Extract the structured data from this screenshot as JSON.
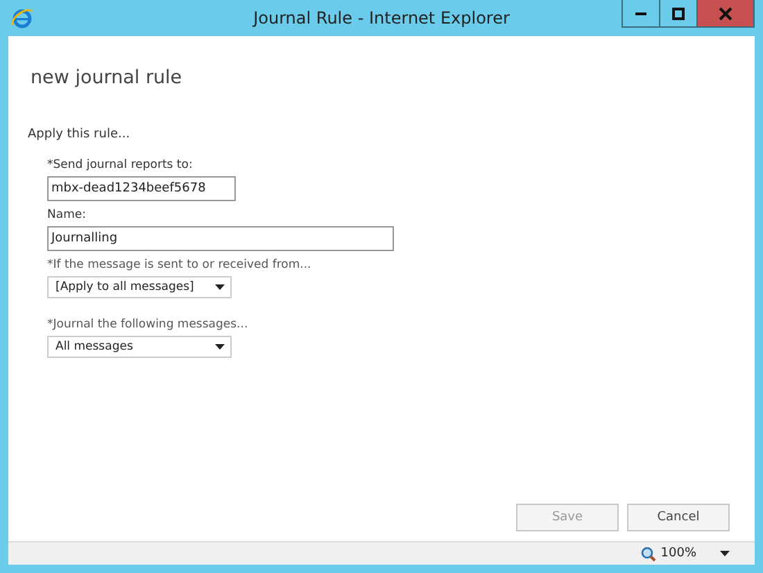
{
  "window": {
    "title": "Journal Rule - Internet Explorer"
  },
  "page": {
    "heading": "new journal rule",
    "intro": "Apply this rule..."
  },
  "fields": [
    {
      "kind": "text",
      "label": "*Send journal reports to:",
      "value": "mbx-dead1234beef5678"
    },
    {
      "kind": "text",
      "label": "Name:",
      "value": "Journalling"
    },
    {
      "kind": "select",
      "label": "*If the message is sent to or received from...",
      "value": "[Apply to all messages]"
    },
    {
      "kind": "select",
      "label": "*Journal the following messages...",
      "value": "All messages"
    }
  ],
  "buttons": [
    {
      "label": "Save",
      "disabled": true
    },
    {
      "label": "Cancel",
      "disabled": false
    }
  ],
  "status_bar": {
    "zoom": "100%"
  }
}
